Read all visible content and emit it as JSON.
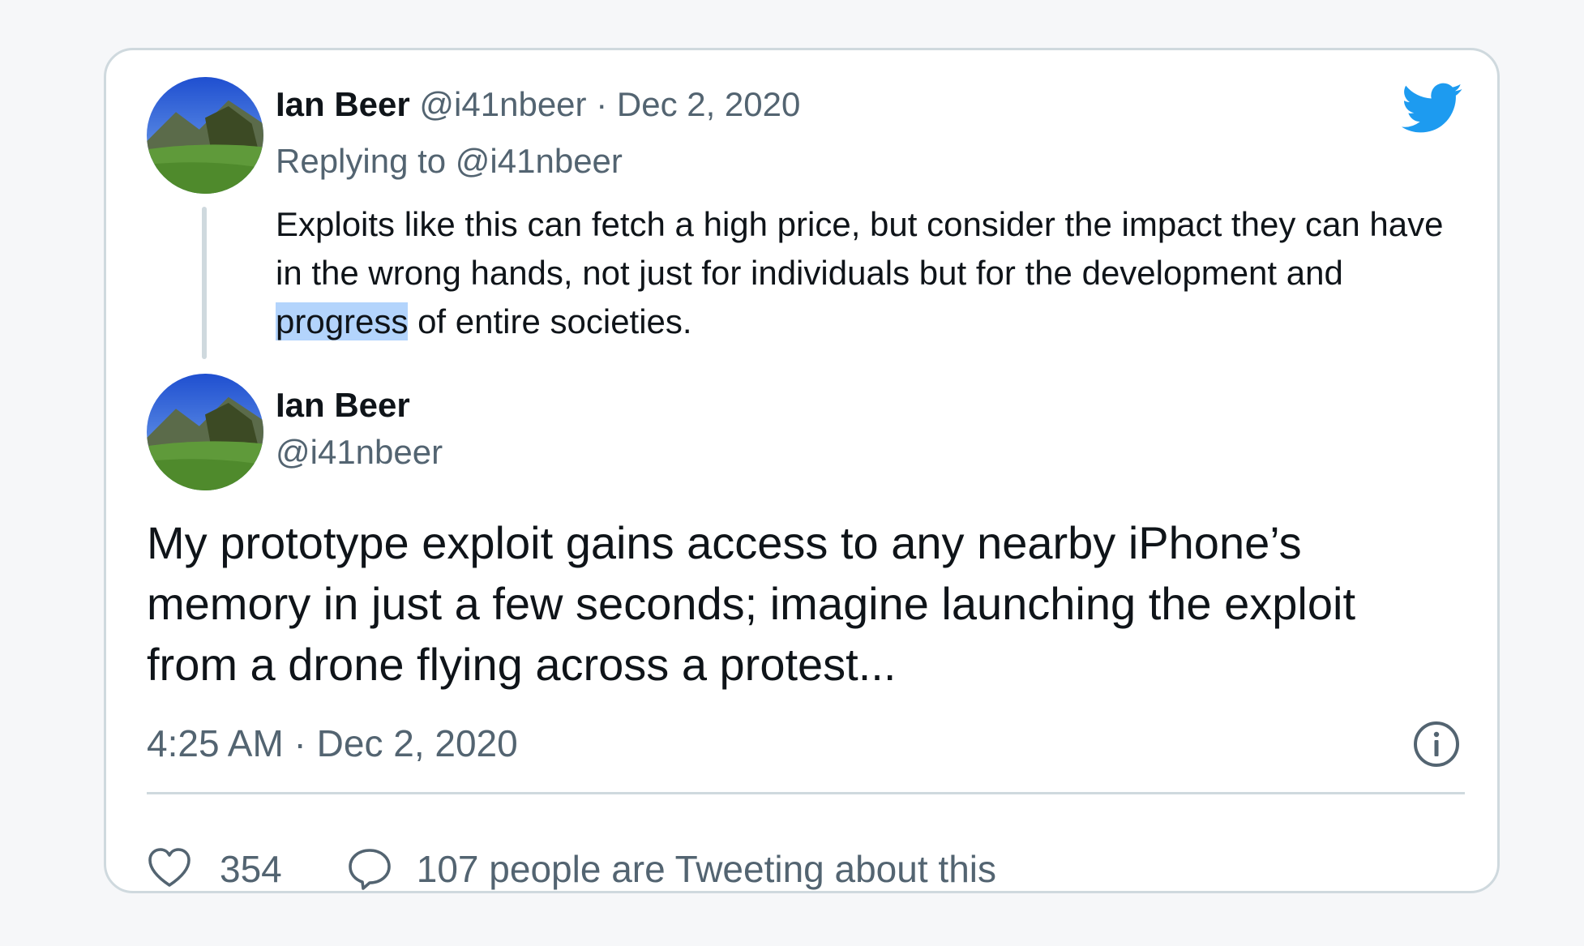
{
  "parent_tweet": {
    "author_name": "Ian Beer",
    "author_handle": "@i41nbeer",
    "separator": "·",
    "date": "Dec 2, 2020",
    "replying_to": "Replying to @i41nbeer",
    "text_before": "Exploits like this can fetch a high price, but consider the impact they can have in the wrong hands, not just for individuals but for the development and ",
    "text_highlight": "progress",
    "text_after": " of entire societies."
  },
  "main_tweet": {
    "author_name": "Ian Beer",
    "author_handle": "@i41nbeer",
    "text": "My prototype exploit gains access to any nearby iPhone’s memory in just a few seconds; imagine launching the exploit from a drone flying across a protest...",
    "timestamp": "4:25 AM · Dec 2, 2020"
  },
  "footer": {
    "like_count": "354",
    "tweeting_text": "107 people are Tweeting about this"
  },
  "icons": {
    "brand": "twitter-bird-icon",
    "info": "info-icon",
    "like": "heart-icon",
    "reply": "speech-bubble-icon"
  },
  "colors": {
    "brand": "#1d9bf0",
    "text": "#0f1419",
    "muted": "#536471",
    "border": "#cfd9de",
    "highlight": "#b3d4fc"
  }
}
